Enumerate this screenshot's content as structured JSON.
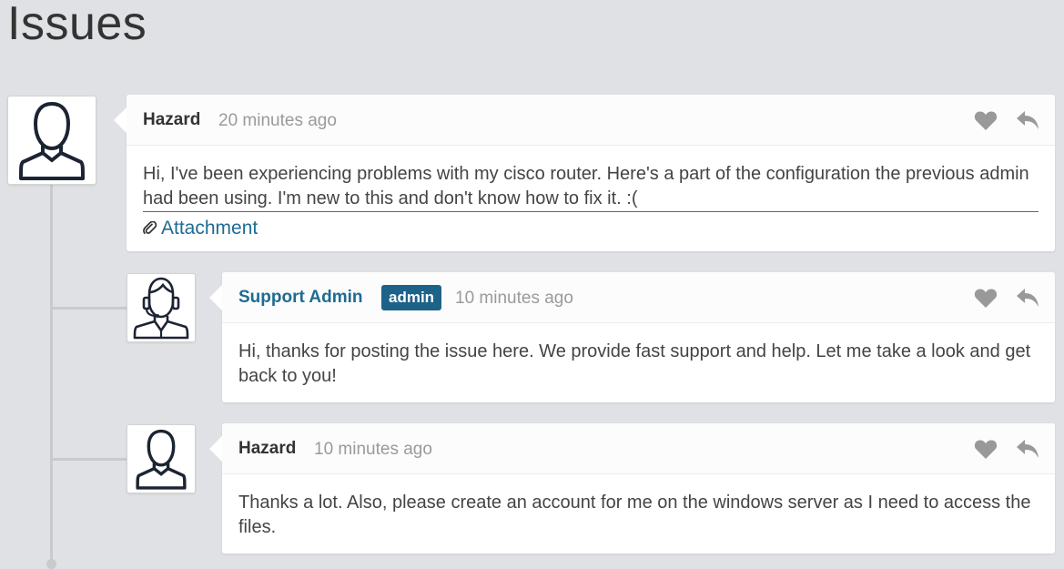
{
  "page": {
    "title": "Issues"
  },
  "comments": [
    {
      "author": "Hazard",
      "time": "20 minutes ago",
      "body": "Hi, I've been experiencing problems with my cisco router. Here's a part of the configuration the previous admin had been using. I'm new to this and don't know how to fix it. :(",
      "attachment_label": "Attachment",
      "avatar_icon": "user-icon"
    },
    {
      "author": "Support Admin",
      "badge": "admin",
      "time": "10 minutes ago",
      "body": "Hi, thanks for posting the issue here. We provide fast support and help. Let me take a look and get back to you!",
      "avatar_icon": "support-agent-icon"
    },
    {
      "author": "Hazard",
      "time": "10 minutes ago",
      "body": "Thanks a lot. Also, please create an account for me on the windows server as I need to access the files.",
      "avatar_icon": "user-icon"
    }
  ],
  "colors": {
    "background": "#dfe1e4",
    "link": "#1e6b92",
    "badge": "#1d6289",
    "icon": "#999999"
  }
}
